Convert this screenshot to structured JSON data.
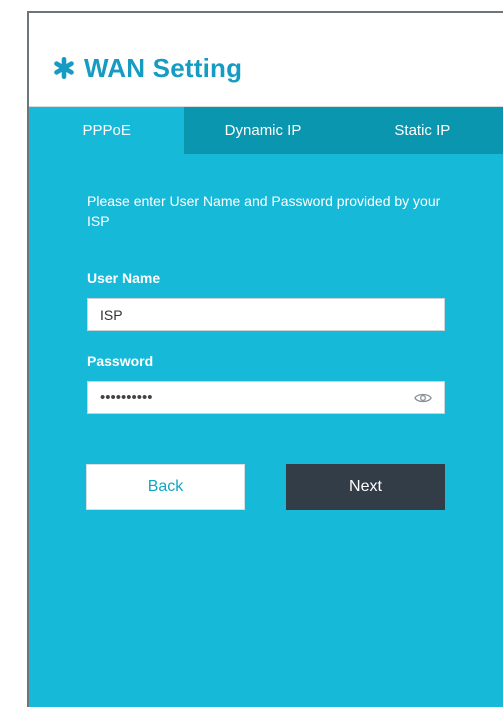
{
  "header": {
    "title": "WAN Setting",
    "icon": "asterisk-icon",
    "accent_color": "#169cc2"
  },
  "tabs": [
    {
      "label": "PPPoE",
      "active": true
    },
    {
      "label": "Dynamic IP",
      "active": false
    },
    {
      "label": "Static IP",
      "active": false
    }
  ],
  "form": {
    "intro": "Please enter User Name and Password provided by your ISP",
    "username": {
      "label": "User Name",
      "value": "ISP"
    },
    "password": {
      "label": "Password",
      "value": "••••••••••",
      "toggle_icon": "eye-icon"
    }
  },
  "buttons": {
    "back_label": "Back",
    "next_label": "Next"
  },
  "colors": {
    "panel_bg": "#16b9d8",
    "tab_inactive_bg": "#0a96ae",
    "next_button_bg": "#333d47"
  }
}
